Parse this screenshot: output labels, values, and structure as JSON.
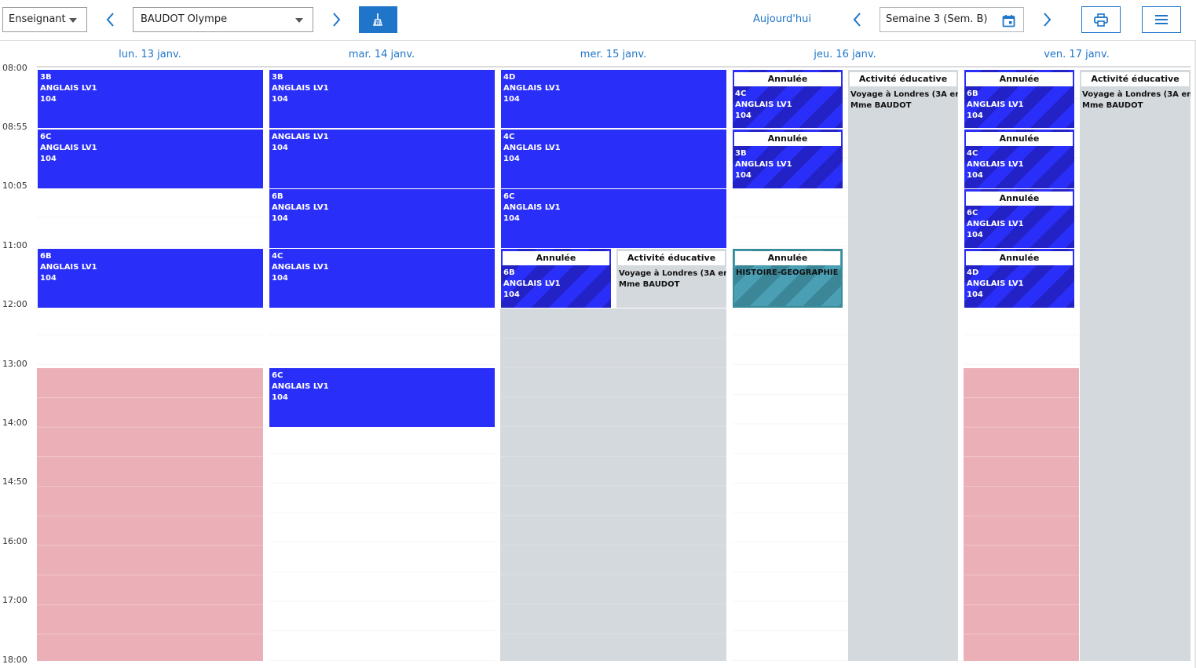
{
  "toolbar": {
    "role_select": "Enseignant",
    "teacher_select": "BAUDOT Olympe",
    "today_label": "Aujourd'hui",
    "week_select": "Semaine 3 (Sem. B)"
  },
  "days": [
    "lun. 13 janv.",
    "mar. 14 janv.",
    "mer. 15 janv.",
    "jeu. 16 janv.",
    "ven. 17 janv."
  ],
  "hours": [
    "08:00",
    "08:55",
    "10:05",
    "11:00",
    "12:00",
    "13:00",
    "14:00",
    "14:50",
    "16:00",
    "17:00",
    "18:00"
  ],
  "events": {
    "mon_1": {
      "cls": "3B",
      "subject": "ANGLAIS LV1",
      "room": "104"
    },
    "mon_2": {
      "cls": "6C",
      "subject": "ANGLAIS LV1",
      "room": "104"
    },
    "mon_3": {
      "cls": "6B",
      "subject": "ANGLAIS LV1",
      "room": "104"
    },
    "tue_1": {
      "cls": "3B",
      "subject": "ANGLAIS LV1",
      "room": "104"
    },
    "tue_2": {
      "subject": "ANGLAIS LV1",
      "room": "104"
    },
    "tue_3": {
      "cls": "6B",
      "subject": "ANGLAIS LV1",
      "room": "104"
    },
    "tue_4": {
      "cls": "4C",
      "subject": "ANGLAIS LV1",
      "room": "104"
    },
    "tue_5": {
      "cls": "6C",
      "subject": "ANGLAIS LV1",
      "room": "104"
    },
    "wed_1": {
      "cls": "4D",
      "subject": "ANGLAIS LV1",
      "room": "104"
    },
    "wed_2": {
      "cls": "4C",
      "subject": "ANGLAIS LV1",
      "room": "104"
    },
    "wed_3": {
      "cls": "6C",
      "subject": "ANGLAIS LV1",
      "room": "104"
    },
    "wed_4": {
      "status": "Annulée",
      "cls": "6B",
      "subject": "ANGLAIS LV1",
      "room": "104"
    },
    "wed_act": {
      "status": "Activité éducative",
      "line1": "Voyage à Londres (3A en",
      "line2": "Mme BAUDOT"
    },
    "thu_1": {
      "status": "Annulée",
      "cls": "4C",
      "subject": "ANGLAIS LV1",
      "room": "104"
    },
    "thu_2": {
      "status": "Annulée",
      "cls": "3B",
      "subject": "ANGLAIS LV1",
      "room": "104"
    },
    "thu_3": {
      "status": "Annulée",
      "subject": "HISTOIRE-GEOGRAPHIE"
    },
    "thu_act": {
      "status": "Activité éducative",
      "line1": "Voyage à Londres (3A en",
      "line2": "Mme BAUDOT"
    },
    "fri_1": {
      "status": "Annulée",
      "cls": "6B",
      "subject": "ANGLAIS LV1",
      "room": "104"
    },
    "fri_2": {
      "status": "Annulée",
      "cls": "4C",
      "subject": "ANGLAIS LV1",
      "room": "104"
    },
    "fri_3": {
      "status": "Annulée",
      "cls": "6C",
      "subject": "ANGLAIS LV1",
      "room": "104"
    },
    "fri_4": {
      "status": "Annulée",
      "cls": "4D",
      "subject": "ANGLAIS LV1",
      "room": "104"
    },
    "fri_act": {
      "status": "Activité éducative",
      "line1": "Voyage à Londres (3A en",
      "line2": "Mme BAUDOT"
    }
  },
  "icons": {
    "prev": "chevron-left-icon",
    "next": "chevron-right-icon",
    "action": "broom-icon",
    "calendar": "calendar-icon",
    "print": "printer-icon",
    "menu": "hamburger-menu-icon"
  },
  "colors": {
    "accent": "#1f75c9",
    "course": "#2a2ef9",
    "cancelled_hatch": "#2222c6",
    "teal": "#4a9fb4",
    "absence": "#ebb0b7",
    "unavailable": "#d4d9de"
  }
}
